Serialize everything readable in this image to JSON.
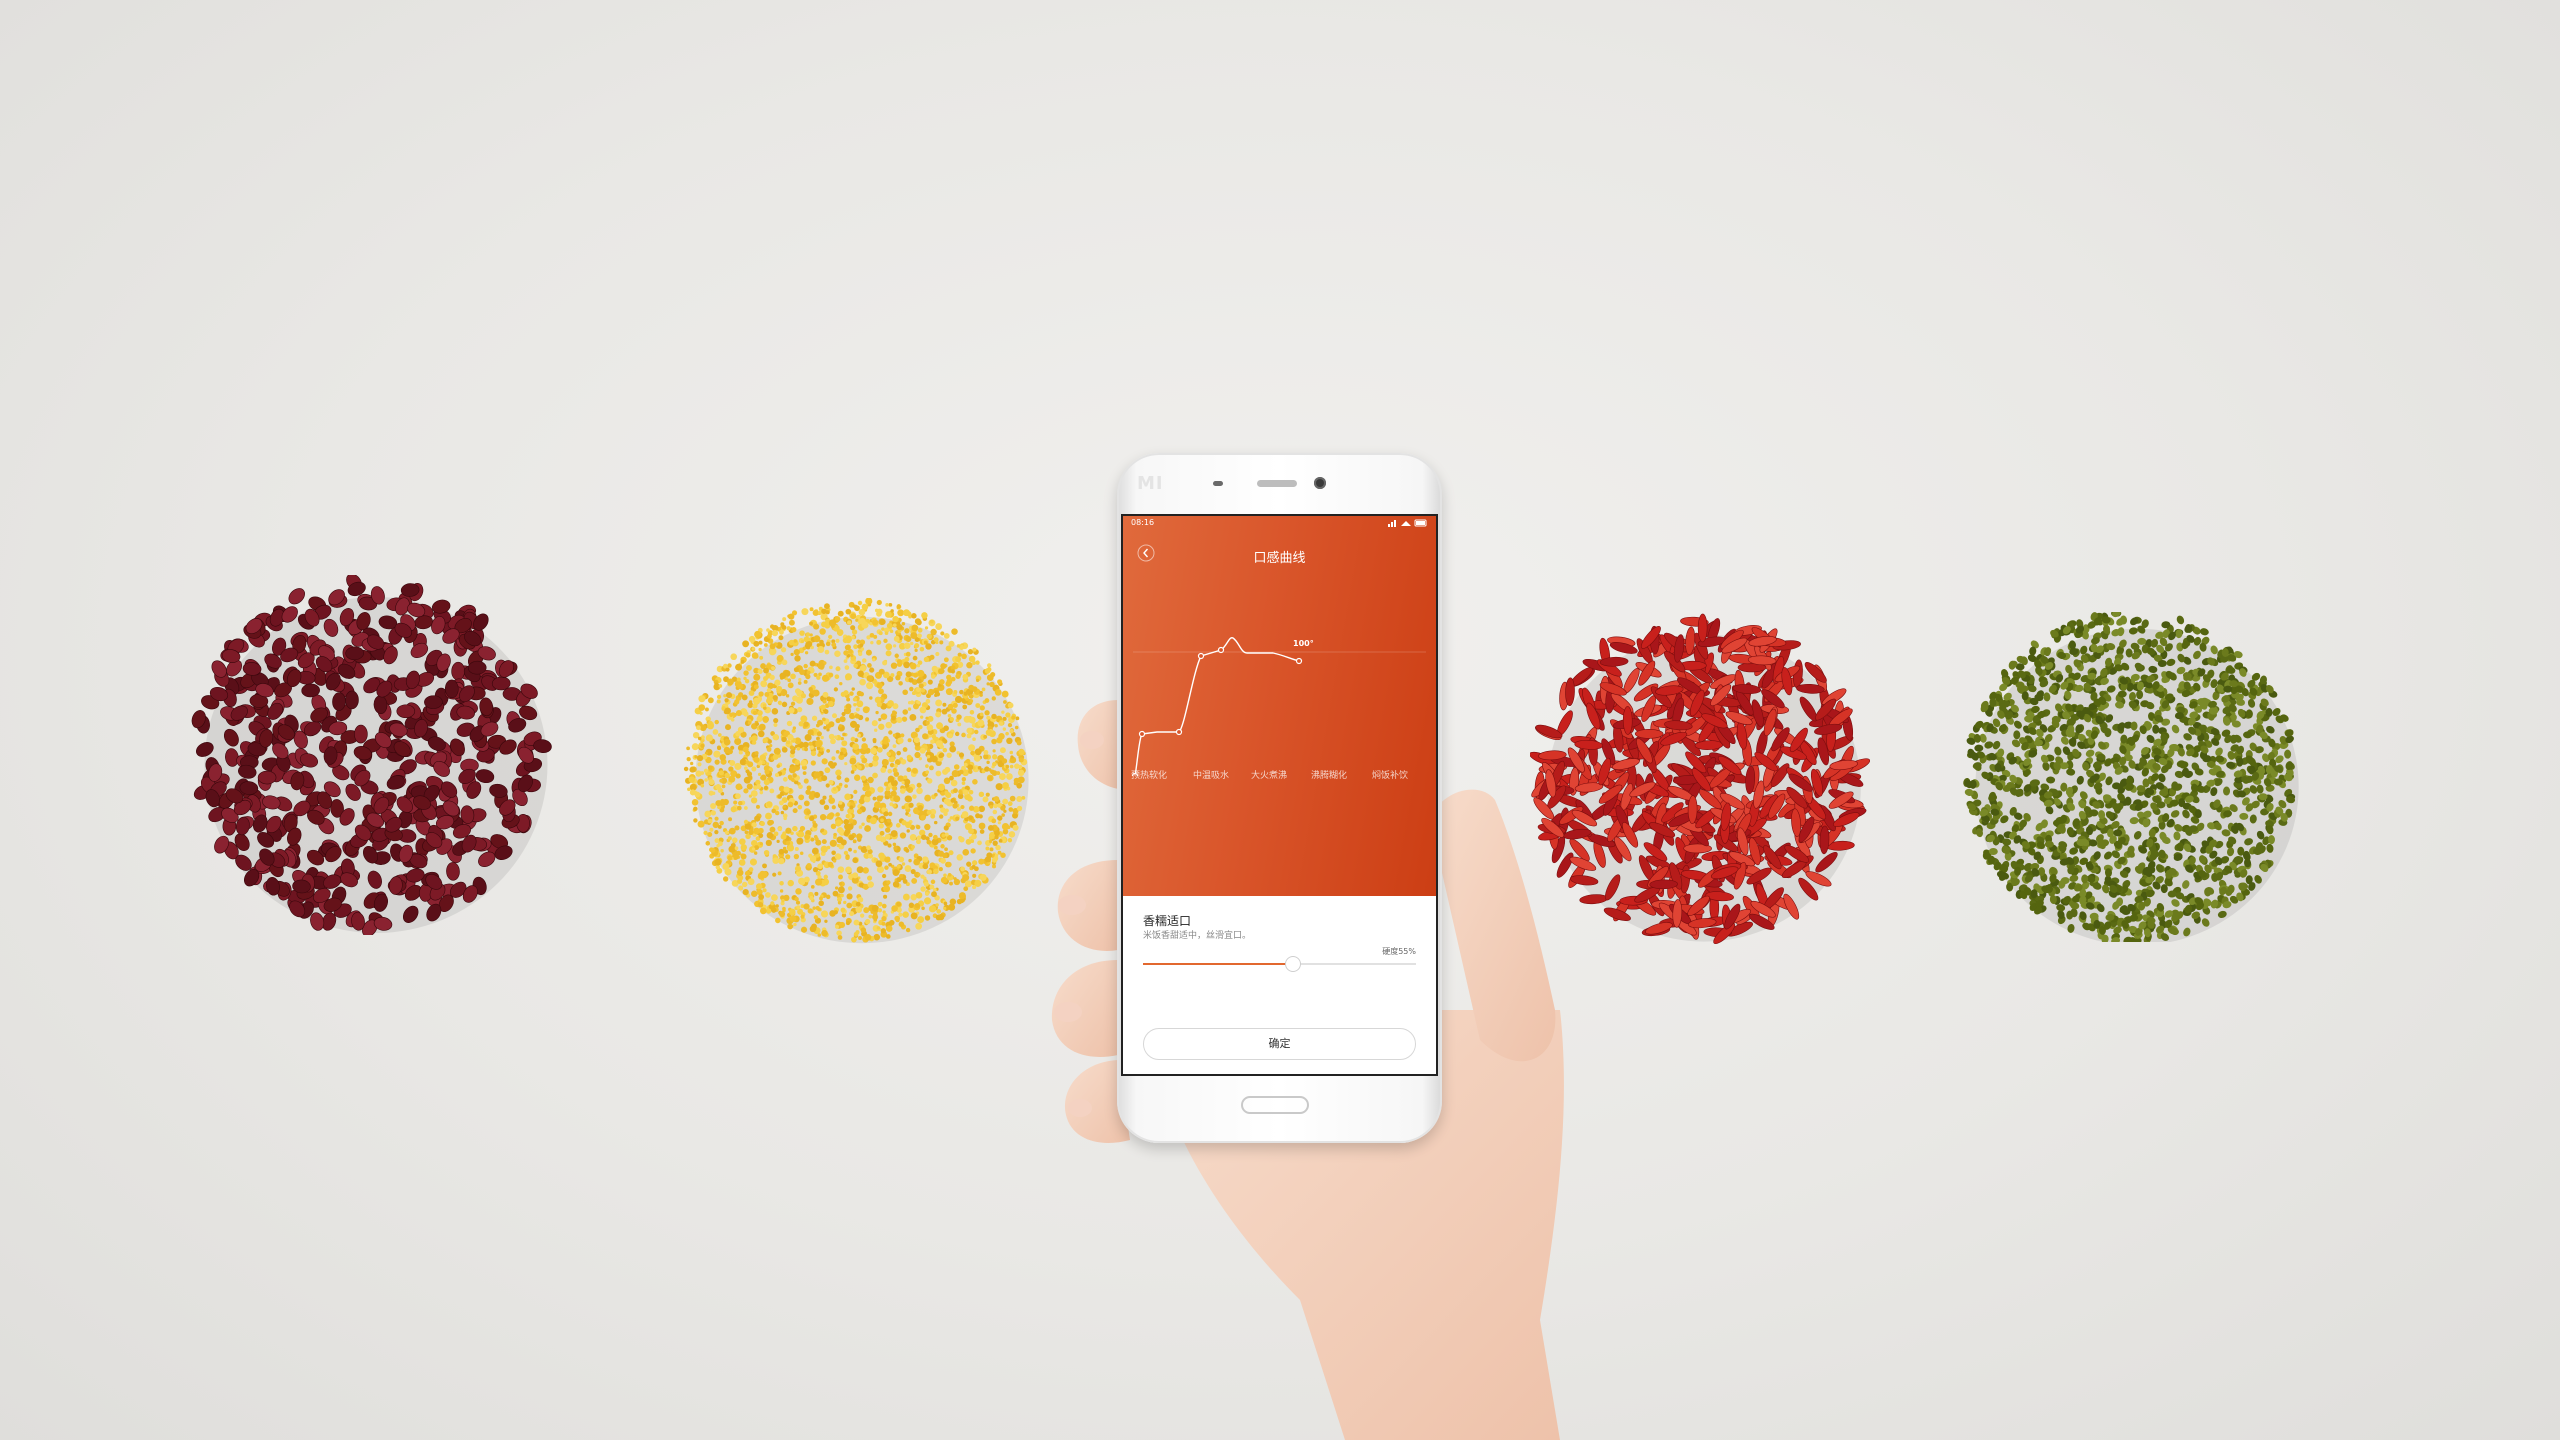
{
  "phone": {
    "brand": "MI"
  },
  "status_bar": {
    "time": "08:16"
  },
  "app": {
    "back_icon": "chevron-left-icon",
    "title": "口感曲线"
  },
  "chart_data": {
    "type": "line",
    "x": [
      "预热软化",
      "中温吸水",
      "大火煮沸",
      "沸腾糊化",
      "焖饭补饮"
    ],
    "annotations": [
      "100°"
    ],
    "color": "#ffffff"
  },
  "panel": {
    "heading": "香糯适口",
    "description": "米饭香甜适中，丝滑宜口。",
    "hardness_label": "硬度55%",
    "hardness_value": 55,
    "confirm_label": "确定"
  },
  "colors": {
    "accent": "#d9552a",
    "slider_fill": "#e2682f",
    "background": "#ebeae7"
  }
}
